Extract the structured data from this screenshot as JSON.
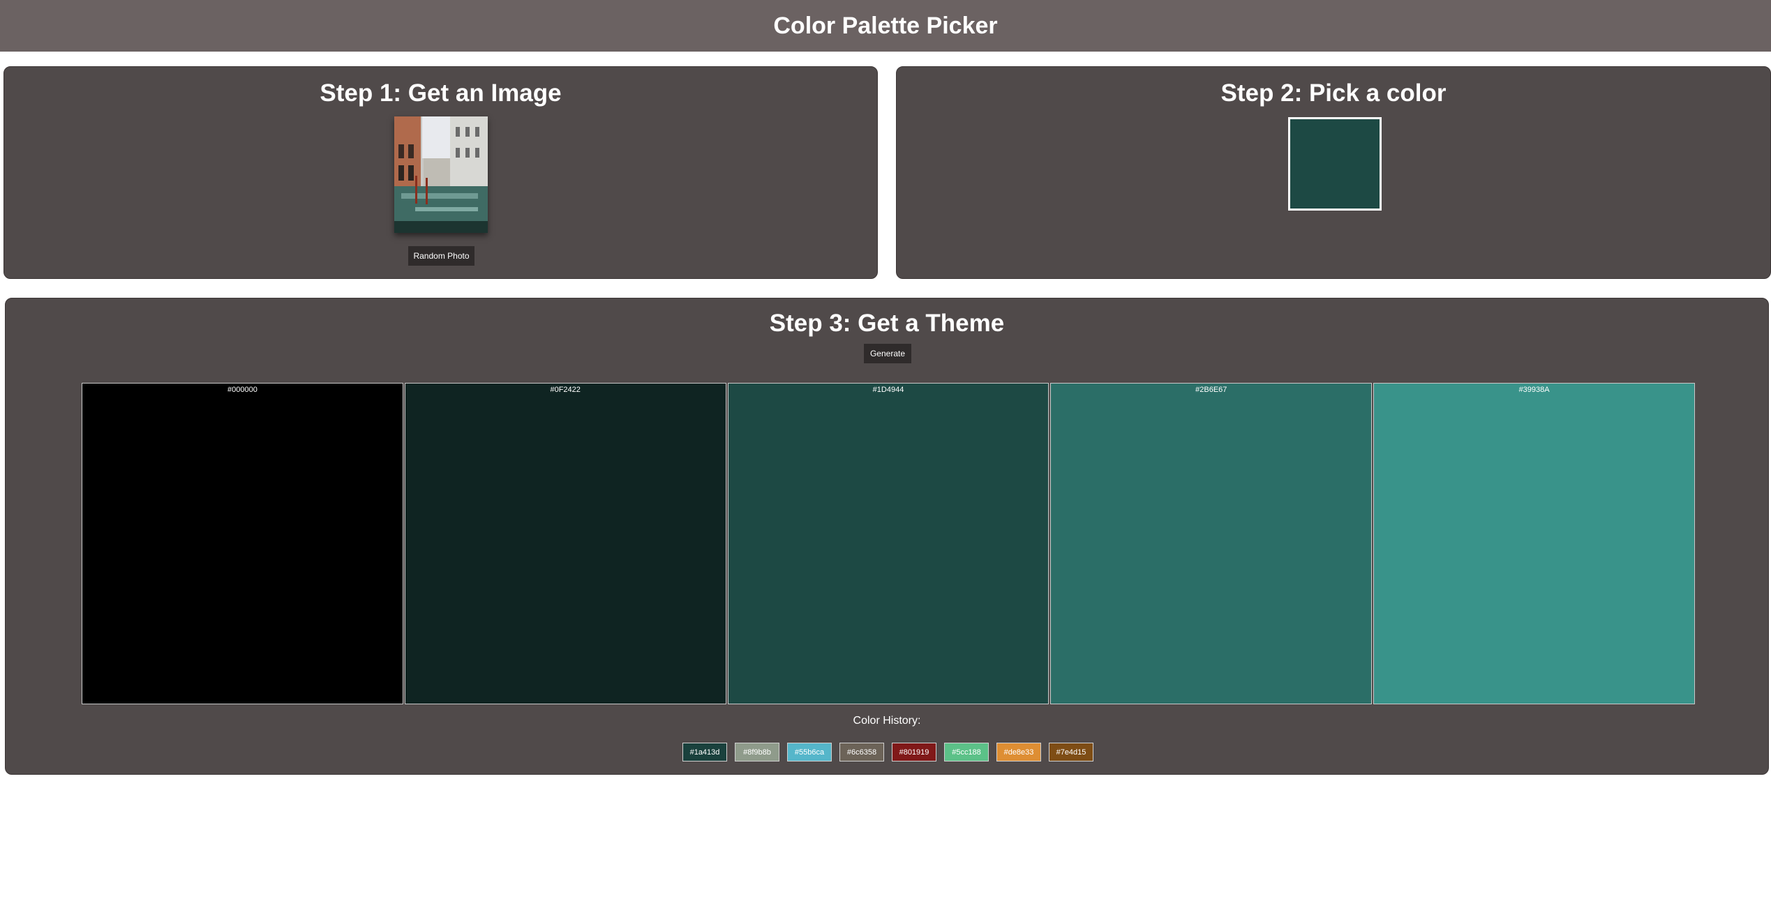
{
  "header": {
    "title": "Color Palette Picker"
  },
  "step1": {
    "title": "Step 1: Get an Image",
    "button_label": "Random Photo"
  },
  "step2": {
    "title": "Step 2: Pick a color",
    "selected_color": "#1D4944"
  },
  "step3": {
    "title": "Step 3: Get a Theme",
    "button_label": "Generate",
    "palette": [
      {
        "hex": "#000000",
        "color": "#000000"
      },
      {
        "hex": "#0F2422",
        "color": "#0F2422"
      },
      {
        "hex": "#1D4944",
        "color": "#1D4944"
      },
      {
        "hex": "#2B6E67",
        "color": "#2B6E67"
      },
      {
        "hex": "#39938A",
        "color": "#39938A"
      }
    ],
    "history_label": "Color History:",
    "history": [
      {
        "hex": "#1a413d",
        "color": "#1a413d"
      },
      {
        "hex": "#8f9b8b",
        "color": "#8f9b8b"
      },
      {
        "hex": "#55b6ca",
        "color": "#55b6ca"
      },
      {
        "hex": "#6c6358",
        "color": "#6c6358"
      },
      {
        "hex": "#801919",
        "color": "#801919"
      },
      {
        "hex": "#5cc188",
        "color": "#5cc188"
      },
      {
        "hex": "#de8e33",
        "color": "#de8e33"
      },
      {
        "hex": "#7e4d15",
        "color": "#7e4d15"
      }
    ]
  }
}
